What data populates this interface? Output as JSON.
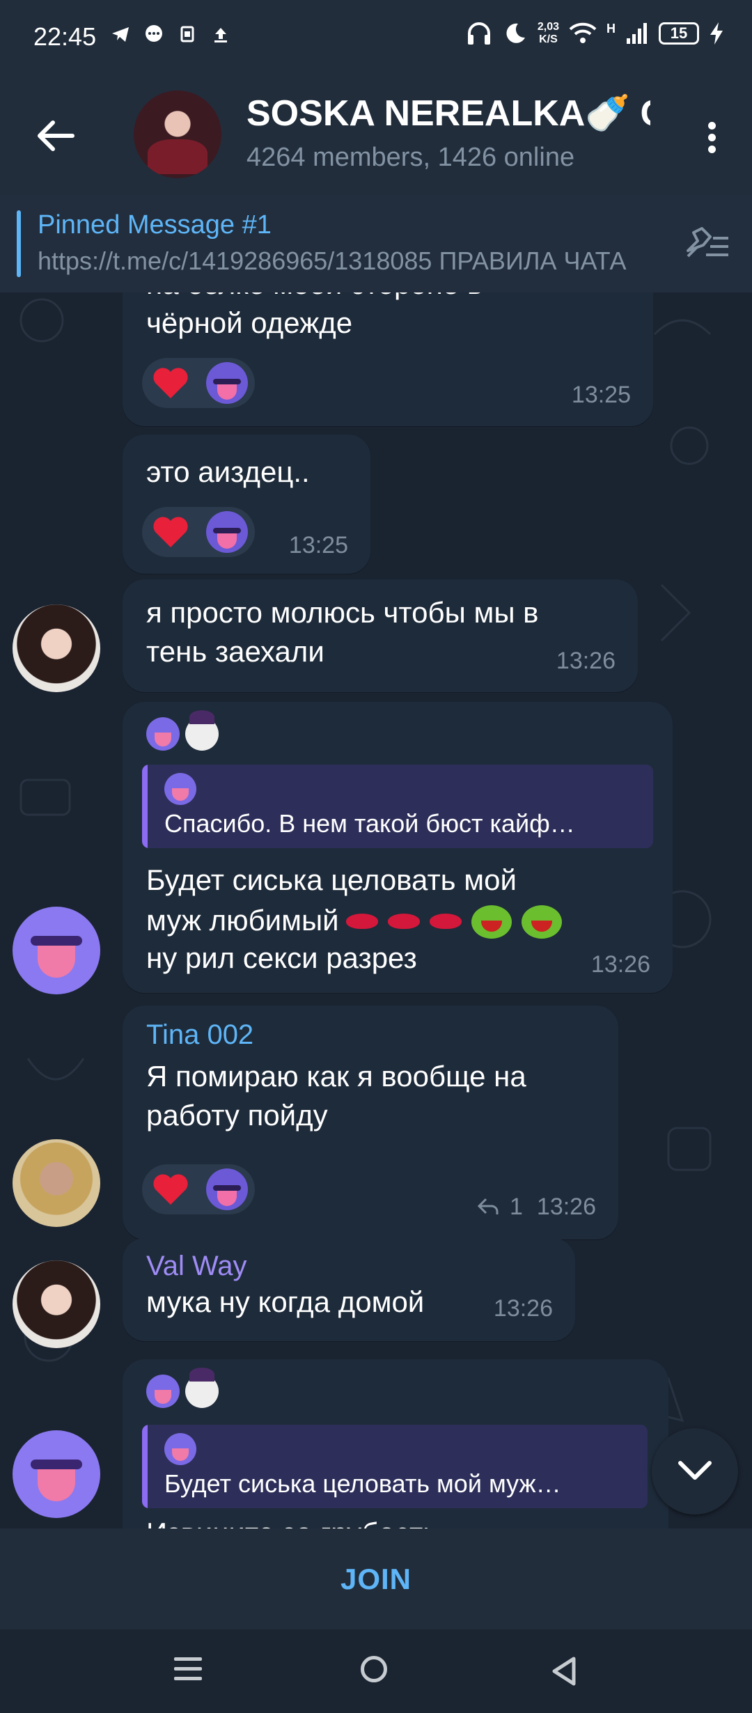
{
  "status_bar": {
    "time": "22:45",
    "net_rate_top": "2,03",
    "net_rate_bottom": "K/S",
    "signal_type": "H",
    "battery": "15",
    "icons": [
      "telegram-bird-icon",
      "messenger-icon",
      "sim-icon",
      "upload-icon",
      "headphones-icon",
      "moon-icon",
      "wifi-icon",
      "signal-icon",
      "charging-icon"
    ]
  },
  "header": {
    "title": "SOSKA NEREALKA🍼 Ch",
    "subtitle": "4264 members, 1426 online"
  },
  "pinned": {
    "title": "Pinned Message #1",
    "text": "https://t.me/c/1419286965/1318085  ПРАВИЛА ЧАТА"
  },
  "messages": [
    {
      "text_partial_top": "на белке моей стороне в",
      "text": "чёрной одежде",
      "time": "13:25",
      "reactions": [
        "heart",
        "tongue"
      ]
    },
    {
      "text": "это аиздец..",
      "time": "13:25",
      "reactions": [
        "heart",
        "tongue"
      ]
    },
    {
      "text_line1": "я просто молюсь чтобы мы в",
      "text_line2": "тень заехали",
      "time": "13:26"
    },
    {
      "quote_text": "Спасибо. В нем такой бюст кайф…",
      "text_line1": "Будет сиська целовать мой",
      "text_line2": "муж любимый",
      "text_line3": "ну рил секси разрез",
      "time": "13:26"
    },
    {
      "sender": "Tina 002",
      "sender_color": "#5eb5f7",
      "text_line1": "Я помираю как я вообще на",
      "text_line2": "работу пойду",
      "reply_count": "1",
      "time": "13:26",
      "reactions": [
        "heart",
        "tongue"
      ]
    },
    {
      "sender": "Val Way",
      "sender_color": "#9f8cf5",
      "text": "мука ну когда домой",
      "time": "13:26"
    },
    {
      "quote_text": "Будет сиська целовать мой муж…",
      "text_partial_bottom": "Извините за грубость"
    }
  ],
  "join_bar": {
    "label": "JOIN"
  },
  "colors": {
    "accent": "#5eb5f7",
    "background": "#1b2431",
    "bubble": "#1e2b3a",
    "header": "#212d3b"
  }
}
